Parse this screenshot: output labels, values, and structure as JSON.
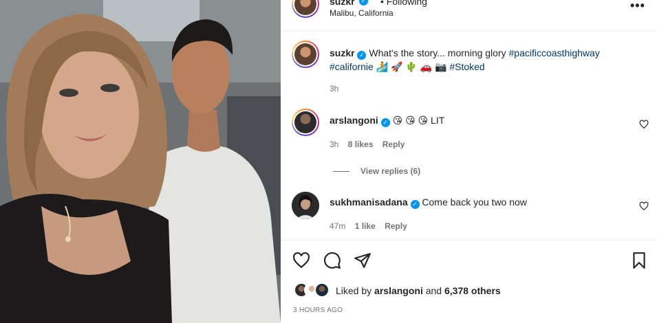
{
  "header": {
    "username": "suzkr",
    "follow_status": "• Following",
    "location": "Malibu, California",
    "more_label": "•••"
  },
  "caption": {
    "username": "suzkr",
    "text": "What's the story... morning glory",
    "hashtag1": "#pacificcoasthighway",
    "hashtag2": "#californie",
    "emojis": "🏄 🚀 🌵 🚗 📷",
    "hashtag3": "#Stoked",
    "time": "3h"
  },
  "comments": [
    {
      "username": "arslangoni",
      "text": "😘 😘 😘  LIT",
      "time": "3h",
      "likes": "8 likes",
      "reply_label": "Reply"
    },
    {
      "username": "sukhmanisadana",
      "text": "Come back you two now",
      "time": "47m",
      "likes": "1 like",
      "reply_label": "Reply"
    }
  ],
  "view_replies": "View replies (6)",
  "likes_bar": {
    "prefix": "Liked by",
    "user": "arslangoni",
    "joiner": "and",
    "others": "6,378 others"
  },
  "timestamp": "3 HOURS AGO",
  "icons": [
    "like-heart-icon",
    "comment-icon",
    "share-icon",
    "save-bookmark-icon",
    "more-options-icon",
    "verified-badge-icon"
  ],
  "colors": {
    "link": "#00376b",
    "verified": "#0095f6",
    "muted": "#737373",
    "text": "#262626"
  }
}
